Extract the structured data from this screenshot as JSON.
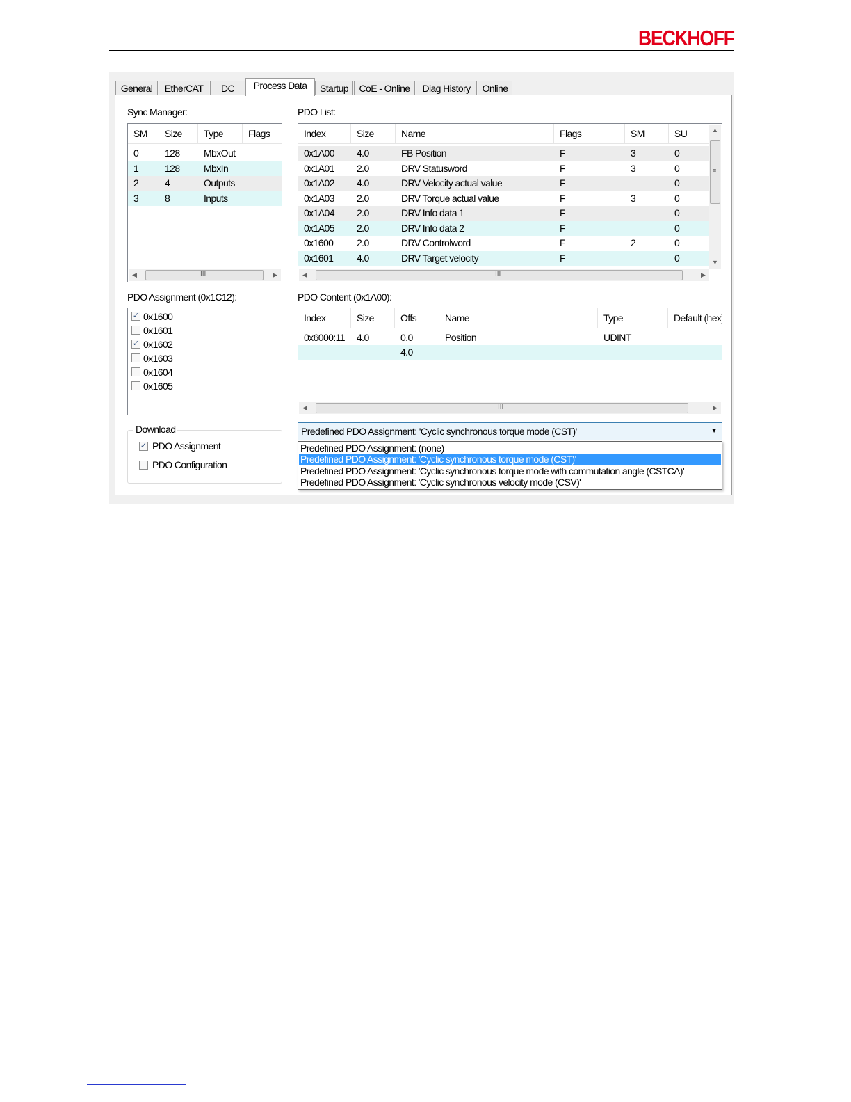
{
  "brand": {
    "logo_text": "BECKHOFF",
    "color": "#e2001a"
  },
  "tabs": [
    {
      "label": "General"
    },
    {
      "label": "EtherCAT"
    },
    {
      "label": "DC"
    },
    {
      "label": "Process Data",
      "active": true
    },
    {
      "label": "Startup"
    },
    {
      "label": "CoE - Online"
    },
    {
      "label": "Diag History"
    },
    {
      "label": "Online"
    }
  ],
  "sync_manager": {
    "label": "Sync Manager:",
    "columns": [
      "SM",
      "Size",
      "Type",
      "Flags"
    ],
    "rows": [
      {
        "sm": "0",
        "size": "128",
        "type": "MbxOut",
        "flags": ""
      },
      {
        "sm": "1",
        "size": "128",
        "type": "MbxIn",
        "flags": ""
      },
      {
        "sm": "2",
        "size": "4",
        "type": "Outputs",
        "flags": ""
      },
      {
        "sm": "3",
        "size": "8",
        "type": "Inputs",
        "flags": ""
      }
    ]
  },
  "pdo_list": {
    "label": "PDO List:",
    "columns": [
      "Index",
      "Size",
      "Name",
      "Flags",
      "SM",
      "SU"
    ],
    "rows": [
      {
        "index": "0x1A00",
        "size": "4.0",
        "name": "FB Position",
        "flags": "F",
        "sm": "3",
        "su": "0"
      },
      {
        "index": "0x1A01",
        "size": "2.0",
        "name": "DRV Statusword",
        "flags": "F",
        "sm": "3",
        "su": "0"
      },
      {
        "index": "0x1A02",
        "size": "4.0",
        "name": "DRV Velocity actual value",
        "flags": "F",
        "sm": "",
        "su": "0"
      },
      {
        "index": "0x1A03",
        "size": "2.0",
        "name": "DRV Torque actual value",
        "flags": "F",
        "sm": "3",
        "su": "0"
      },
      {
        "index": "0x1A04",
        "size": "2.0",
        "name": "DRV Info data 1",
        "flags": "F",
        "sm": "",
        "su": "0"
      },
      {
        "index": "0x1A05",
        "size": "2.0",
        "name": "DRV Info data 2",
        "flags": "F",
        "sm": "",
        "su": "0"
      },
      {
        "index": "0x1600",
        "size": "2.0",
        "name": "DRV Controlword",
        "flags": "F",
        "sm": "2",
        "su": "0"
      },
      {
        "index": "0x1601",
        "size": "4.0",
        "name": "DRV Target velocity",
        "flags": "F",
        "sm": "",
        "su": "0"
      }
    ]
  },
  "pdo_assignment": {
    "label": "PDO Assignment (0x1C12):",
    "items": [
      {
        "label": "0x1600",
        "checked": true
      },
      {
        "label": "0x1601",
        "checked": false
      },
      {
        "label": "0x1602",
        "checked": true
      },
      {
        "label": "0x1603",
        "checked": false
      },
      {
        "label": "0x1604",
        "checked": false
      },
      {
        "label": "0x1605",
        "checked": false
      }
    ]
  },
  "pdo_content": {
    "label": "PDO Content (0x1A00):",
    "columns": [
      "Index",
      "Size",
      "Offs",
      "Name",
      "Type",
      "Default (hex)"
    ],
    "rows": [
      {
        "index": "0x6000:11",
        "size": "4.0",
        "offs": "0.0",
        "name": "Position",
        "type": "UDINT",
        "default": ""
      },
      {
        "index": "",
        "size": "",
        "offs": "4.0",
        "name": "",
        "type": "",
        "default": ""
      }
    ]
  },
  "download": {
    "label": "Download",
    "pdo_assignment": {
      "label": "PDO Assignment",
      "checked": true
    },
    "pdo_configuration": {
      "label": "PDO Configuration",
      "checked": false
    }
  },
  "predefined": {
    "selected": "Predefined PDO Assignment: 'Cyclic synchronous torque mode (CST)'",
    "options": [
      "Predefined PDO Assignment: (none)",
      "Predefined PDO Assignment: 'Cyclic synchronous torque mode (CST)'",
      "Predefined PDO Assignment: 'Cyclic synchronous torque mode with commutation angle (CSTCA)'",
      "Predefined PDO Assignment: 'Cyclic synchronous velocity mode (CSV)'"
    ],
    "selected_index": 1,
    "highlight_color": "#3399ff"
  },
  "scroll_grip": "III"
}
